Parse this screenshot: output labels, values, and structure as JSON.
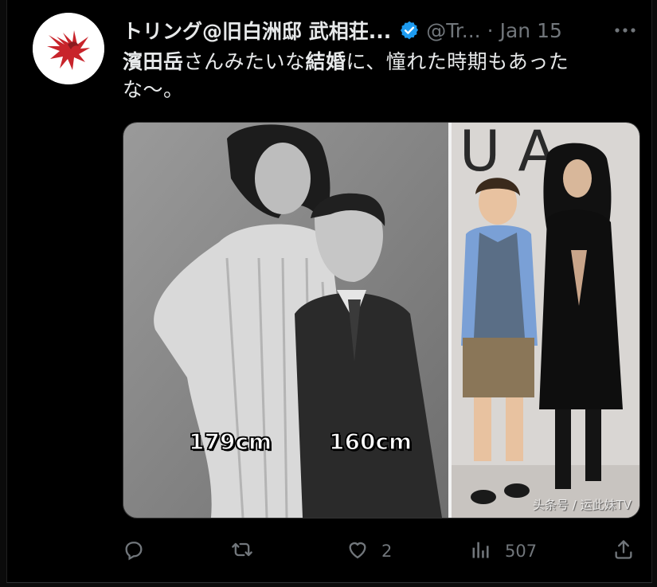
{
  "tweet": {
    "display_name": "トリング@旧白洲邸 武相荘...",
    "handle": "@Tr...",
    "separator": "·",
    "date": "Jan 15",
    "text_bold_1": "濱田岳",
    "text_part_1": "さんみたいな",
    "text_bold_2": "結婚",
    "text_part_2": "に、憧れた時期もあった",
    "text_line_2": "な〜。",
    "icons": {
      "verified": "verified-badge-icon",
      "more": "more-options-icon"
    }
  },
  "media": {
    "left_label_1": "179cm",
    "left_label_2": "160cm",
    "watermark": "头条号 / 运此妹TV"
  },
  "actions": {
    "reply_count": "",
    "retweet_count": "",
    "like_count": "2",
    "views_count": "507",
    "icons": [
      "reply-icon",
      "retweet-icon",
      "like-icon",
      "views-icon",
      "share-icon"
    ]
  },
  "colors": {
    "background": "#000000",
    "text": "#e7e9ea",
    "muted": "#71767b",
    "verified": "#1d9bf0"
  }
}
